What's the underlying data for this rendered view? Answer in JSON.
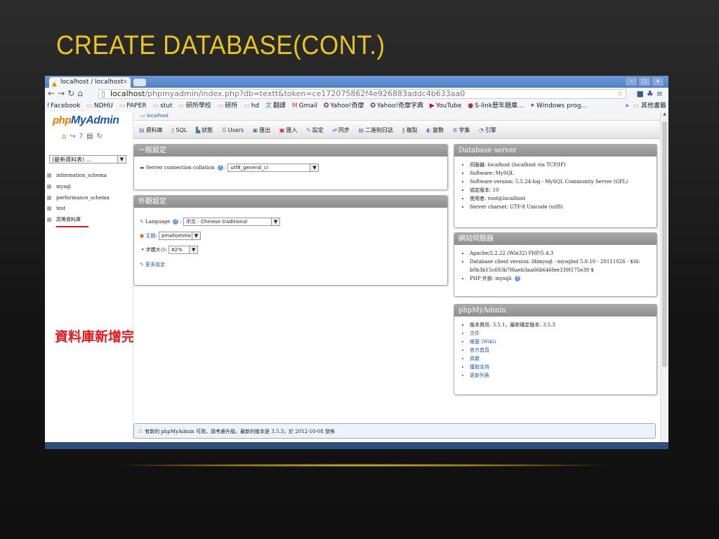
{
  "slide": {
    "title": "CREATE DATABASE(CONT.)",
    "annotation": "資料庫新增完成",
    "title_color": "#e8c220",
    "annotation_color": "#e0191f"
  },
  "browser": {
    "tab_title": "localhost / localhost",
    "tab_close": "×",
    "url_host": "localhost",
    "url_path": "/phpmyadmin/index.php?db=textt&token=ce172075862f4e926883addc4b633aa0",
    "bookmarks": [
      "Facebook",
      "NDHU",
      "PAPER",
      "stut",
      "研所學校",
      "研所",
      "hd",
      "翻譯",
      "Gmail",
      "Yahoo!奇摩",
      "Yahoo!奇摩字典",
      "YouTube",
      "S-link歷年題庫...",
      "Windows prog..."
    ],
    "bookmarks_more": "»",
    "bookmarks_other": "其他書籤"
  },
  "pma": {
    "logo_php": "php",
    "logo_myadmin": "MyAdmin",
    "db_select": "(最新資料表) ...",
    "databases": [
      "information_schema",
      "mysql",
      "performance_schema",
      "test",
      "高等資料庫"
    ],
    "breadcrumb": "localhost",
    "menu": [
      "資料庫",
      "SQL",
      "狀態",
      "Users",
      "匯出",
      "匯入",
      "設定",
      "同步",
      "二進制日誌",
      "複製",
      "變數",
      "字集",
      "引擎"
    ],
    "general": {
      "title": "一般設定",
      "collation_label": "Server connection collation",
      "collation_value": "utf8_general_ci"
    },
    "appearance": {
      "title": "外觀設定",
      "language_label": "Language",
      "language_value": "中文 - Chinese traditional",
      "theme_label": "主題",
      "theme_value": "pmahomme",
      "fontsize_label": "字體大小",
      "fontsize_value": "82%",
      "more_settings": "更多設定"
    },
    "db_server": {
      "title": "Database server",
      "items": [
        "伺服器: localhost (localhost via TCP/IP)",
        "Software: MySQL",
        "Software version: 5.5.24-log - MySQL Community Server (GPL)",
        "協定版本: 10",
        "使用者: root@localhost",
        "Server charset: UTF-8 Unicode (utf8)"
      ]
    },
    "web_server": {
      "title": "網站伺服器",
      "items": [
        "Apache/2.2.22 (Win32) PHP/5.4.3",
        "Database client version: libmysql - mysqlnd 5.0.10 - 20111026 - $Id:",
        "b0b3b15c693b7f6aeb3aa66b646fee339f175e39 $",
        "PHP 外掛: mysqli"
      ]
    },
    "pma_info": {
      "title": "phpMyAdmin",
      "items": [
        "版本資訊: 3.5.1，最新穩定版本: 3.5.3",
        "文件",
        "維基 (Wiki)",
        "官方首頁",
        "貢獻",
        "獲取支持",
        "更新列表"
      ]
    },
    "notice": "有新的 phpMyAdmin 可用，請考慮升級。最新的版本是 3.5.3，於 2012-10-08 發佈"
  }
}
